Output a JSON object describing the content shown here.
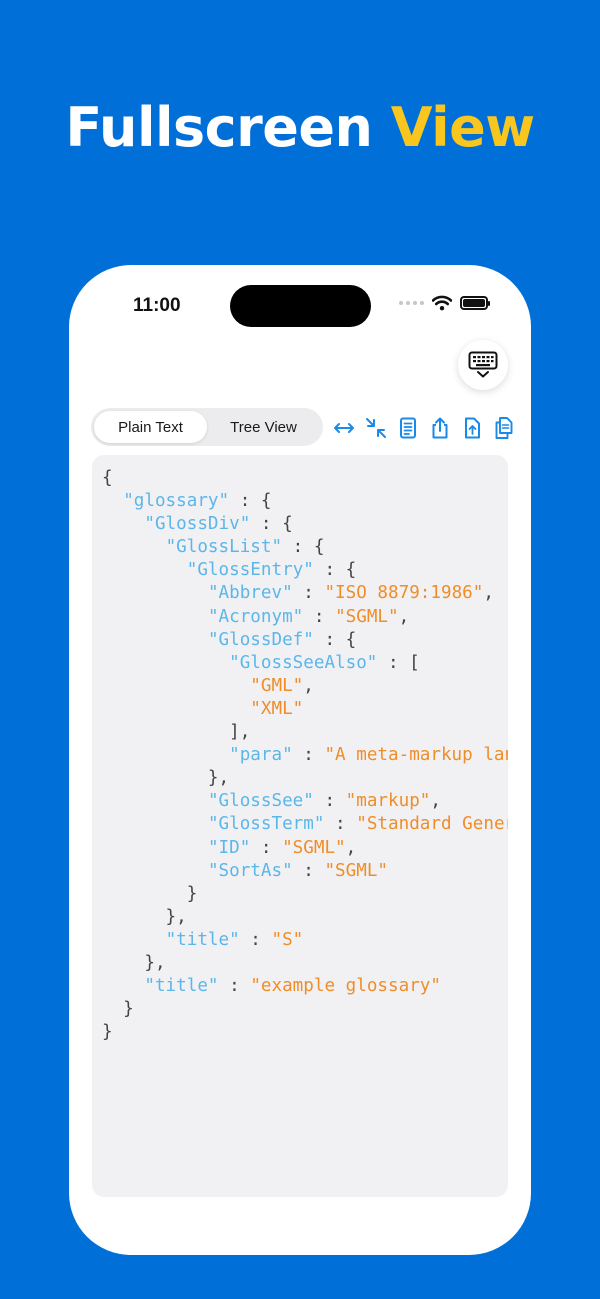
{
  "headline": {
    "part1": "Fullscreen ",
    "part2": "View"
  },
  "status_bar": {
    "time": "11:00"
  },
  "colors": {
    "background": "#0070d8",
    "accent": "#f8c61e",
    "tool_icon": "#1a8ae8",
    "json_key": "#5bb6ea",
    "json_string": "#f08d28"
  },
  "tabs": [
    {
      "label": "Plain Text",
      "active": true
    },
    {
      "label": "Tree View",
      "active": false
    }
  ],
  "toolbar_icons": [
    "expand-horizontal-icon",
    "collapse-icon",
    "document-icon",
    "share-icon",
    "upload-file-icon",
    "copy-icon"
  ],
  "keyboard_button_icon": "keyboard-hide-icon",
  "code_lines": [
    [
      [
        "p",
        "{"
      ]
    ],
    [
      [
        "p",
        "  "
      ],
      [
        "k",
        "\"glossary\""
      ],
      [
        "p",
        " : {"
      ]
    ],
    [
      [
        "p",
        "    "
      ],
      [
        "k",
        "\"GlossDiv\""
      ],
      [
        "p",
        " : {"
      ]
    ],
    [
      [
        "p",
        "      "
      ],
      [
        "k",
        "\"GlossList\""
      ],
      [
        "p",
        " : {"
      ]
    ],
    [
      [
        "p",
        "        "
      ],
      [
        "k",
        "\"GlossEntry\""
      ],
      [
        "p",
        " : {"
      ]
    ],
    [
      [
        "p",
        "          "
      ],
      [
        "k",
        "\"Abbrev\""
      ],
      [
        "p",
        " : "
      ],
      [
        "s",
        "\"ISO 8879:1986\""
      ],
      [
        "p",
        ","
      ]
    ],
    [
      [
        "p",
        "          "
      ],
      [
        "k",
        "\"Acronym\""
      ],
      [
        "p",
        " : "
      ],
      [
        "s",
        "\"SGML\""
      ],
      [
        "p",
        ","
      ]
    ],
    [
      [
        "p",
        "          "
      ],
      [
        "k",
        "\"GlossDef\""
      ],
      [
        "p",
        " : {"
      ]
    ],
    [
      [
        "p",
        "            "
      ],
      [
        "k",
        "\"GlossSeeAlso\""
      ],
      [
        "p",
        " : ["
      ]
    ],
    [
      [
        "p",
        "              "
      ],
      [
        "s",
        "\"GML\""
      ],
      [
        "p",
        ","
      ]
    ],
    [
      [
        "p",
        "              "
      ],
      [
        "s",
        "\"XML\""
      ]
    ],
    [
      [
        "p",
        "            ],"
      ]
    ],
    [
      [
        "p",
        "            "
      ],
      [
        "k",
        "\"para\""
      ],
      [
        "p",
        " : "
      ],
      [
        "s",
        "\"A meta-markup language\""
      ]
    ],
    [
      [
        "p",
        "          },"
      ]
    ],
    [
      [
        "p",
        "          "
      ],
      [
        "k",
        "\"GlossSee\""
      ],
      [
        "p",
        " : "
      ],
      [
        "s",
        "\"markup\""
      ],
      [
        "p",
        ","
      ]
    ],
    [
      [
        "p",
        "          "
      ],
      [
        "k",
        "\"GlossTerm\""
      ],
      [
        "p",
        " : "
      ],
      [
        "s",
        "\"Standard Generalized\""
      ]
    ],
    [
      [
        "p",
        "          "
      ],
      [
        "k",
        "\"ID\""
      ],
      [
        "p",
        " : "
      ],
      [
        "s",
        "\"SGML\""
      ],
      [
        "p",
        ","
      ]
    ],
    [
      [
        "p",
        "          "
      ],
      [
        "k",
        "\"SortAs\""
      ],
      [
        "p",
        " : "
      ],
      [
        "s",
        "\"SGML\""
      ]
    ],
    [
      [
        "p",
        "        }"
      ]
    ],
    [
      [
        "p",
        "      },"
      ]
    ],
    [
      [
        "p",
        "      "
      ],
      [
        "k",
        "\"title\""
      ],
      [
        "p",
        " : "
      ],
      [
        "s",
        "\"S\""
      ]
    ],
    [
      [
        "p",
        "    },"
      ]
    ],
    [
      [
        "p",
        "    "
      ],
      [
        "k",
        "\"title\""
      ],
      [
        "p",
        " : "
      ],
      [
        "s",
        "\"example glossary\""
      ]
    ],
    [
      [
        "p",
        "  }"
      ]
    ],
    [
      [
        "p",
        "}"
      ]
    ]
  ]
}
